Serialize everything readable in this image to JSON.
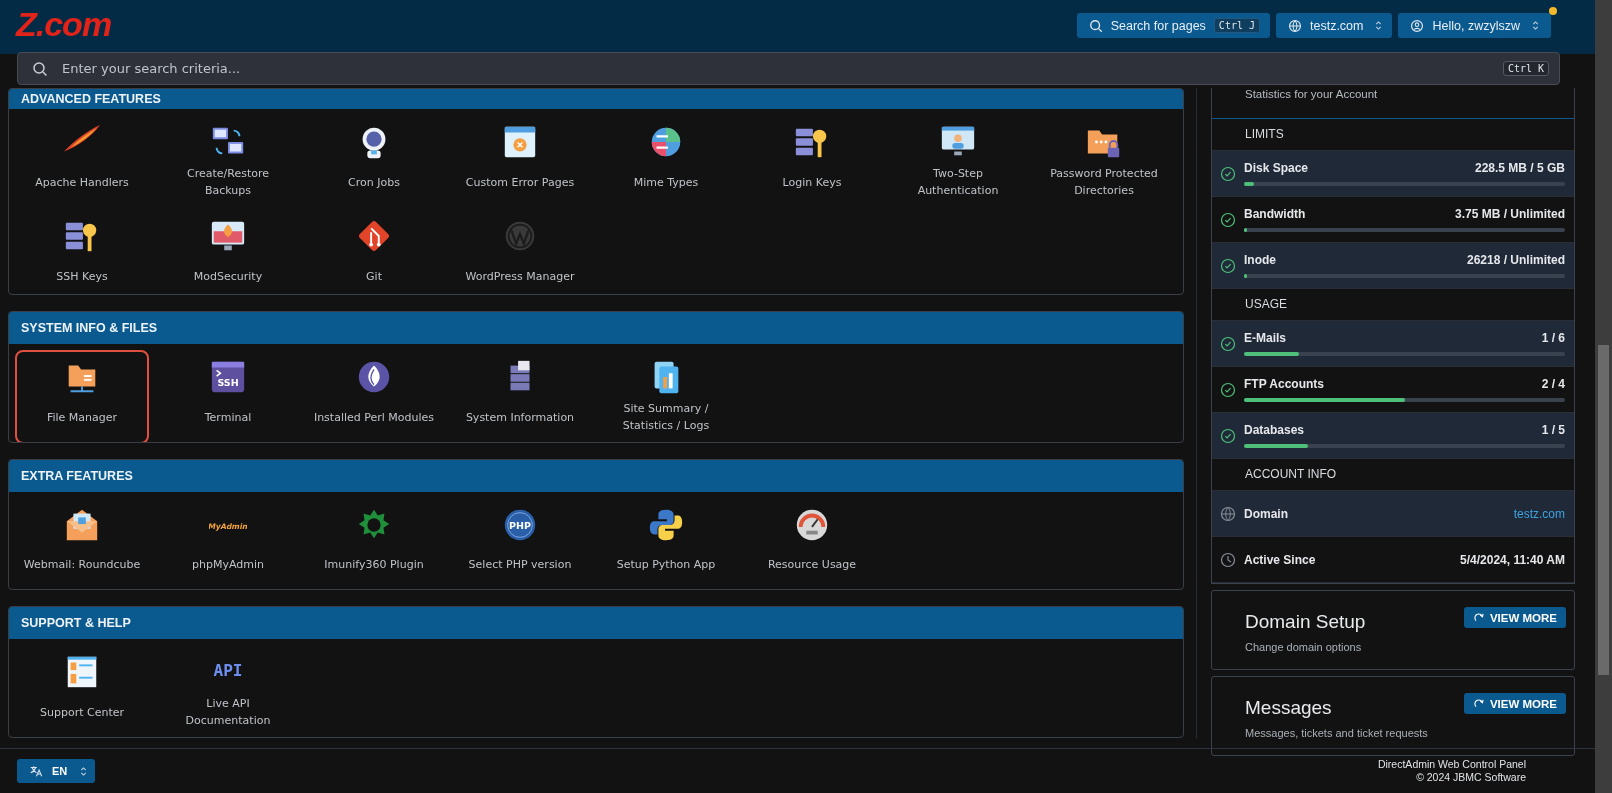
{
  "logo": "Z.com",
  "header": {
    "search_button": {
      "label": "Search for pages",
      "shortcut": "Ctrl J"
    },
    "domain_menu": {
      "label": "testz.com"
    },
    "user_menu": {
      "label": "Hello, zwzylszw",
      "notification": true
    }
  },
  "search": {
    "placeholder": "Enter your search criteria...",
    "shortcut": "Ctrl K"
  },
  "sections": [
    {
      "title": "ADVANCED FEATURES",
      "items": [
        {
          "label": "Apache Handlers",
          "selected": false
        },
        {
          "label": "Create/Restore Backups",
          "selected": false
        },
        {
          "label": "Cron Jobs",
          "selected": false
        },
        {
          "label": "Custom Error Pages",
          "selected": false
        },
        {
          "label": "Mime Types",
          "selected": false
        },
        {
          "label": "Login Keys",
          "selected": false
        },
        {
          "label": "Two-Step Authentication",
          "selected": false
        },
        {
          "label": "Password Protected Directories",
          "selected": false
        },
        {
          "label": "SSH Keys",
          "selected": false
        },
        {
          "label": "ModSecurity",
          "selected": false
        },
        {
          "label": "Git",
          "selected": false
        },
        {
          "label": "WordPress Manager",
          "selected": false
        }
      ]
    },
    {
      "title": "SYSTEM INFO & FILES",
      "items": [
        {
          "label": "File Manager",
          "selected": true
        },
        {
          "label": "Terminal",
          "selected": false,
          "icon_text": "SSH"
        },
        {
          "label": "Installed Perl Modules",
          "selected": false
        },
        {
          "label": "System Information",
          "selected": false
        },
        {
          "label": "Site Summary / Statistics / Logs",
          "selected": false
        }
      ]
    },
    {
      "title": "EXTRA FEATURES",
      "items": [
        {
          "label": "Webmail: Roundcube",
          "selected": false
        },
        {
          "label": "phpMyAdmin",
          "selected": false,
          "icon_text": "MyAdmin"
        },
        {
          "label": "Imunify360 Plugin",
          "selected": false
        },
        {
          "label": "Select PHP version",
          "selected": false,
          "icon_text": "PHP"
        },
        {
          "label": "Setup Python App",
          "selected": false
        },
        {
          "label": "Resource Usage",
          "selected": false
        }
      ]
    },
    {
      "title": "SUPPORT & HELP",
      "items": [
        {
          "label": "Support Center",
          "selected": false
        },
        {
          "label": "Live API Documentation",
          "selected": false,
          "icon_text": "API"
        }
      ]
    }
  ],
  "stats": {
    "subtitle": "Statistics for your Account",
    "groups": [
      {
        "title": "LIMITS",
        "rows": [
          {
            "label": "Disk Space",
            "value": "228.5 MB / 5 GB",
            "level": 0.03
          },
          {
            "label": "Bandwidth",
            "value": "3.75 MB / Unlimited",
            "level": 0.006
          },
          {
            "label": "Inode",
            "value": "26218 / Unlimited",
            "level": 0.006
          }
        ]
      },
      {
        "title": "USAGE",
        "rows": [
          {
            "label": "E-Mails",
            "value": "1 / 6",
            "level": 0.17
          },
          {
            "label": "FTP Accounts",
            "value": "2 / 4",
            "level": 0.5
          },
          {
            "label": "Databases",
            "value": "1 / 5",
            "level": 0.2
          }
        ]
      },
      {
        "title": "ACCOUNT INFO",
        "rows": [
          {
            "kind": "globe",
            "label": "Domain",
            "value": "testz.com",
            "link": true
          },
          {
            "kind": "clock",
            "label": "Active Since",
            "value": "5/4/2024, 11:40 AM",
            "link": false
          }
        ]
      }
    ]
  },
  "cards": [
    {
      "title": "Domain Setup",
      "subtitle": "Change domain options",
      "button": "VIEW MORE"
    },
    {
      "title": "Messages",
      "subtitle": "Messages, tickets and ticket requests",
      "button": "VIEW MORE"
    }
  ],
  "language": {
    "label": "EN"
  },
  "footer": {
    "line_1": "DirectAdmin Web Control Panel",
    "line_2": "© 2024 JBMC Software"
  }
}
